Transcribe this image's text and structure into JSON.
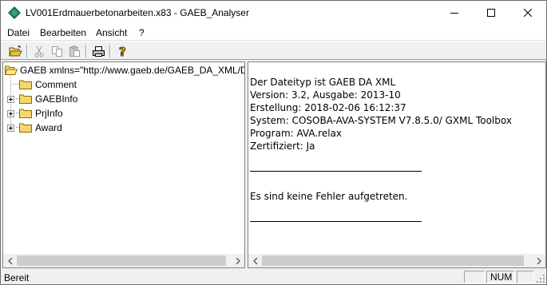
{
  "window": {
    "title": "LV001Erdmauerbetonarbeiten.x83 - GAEB_Analyser"
  },
  "menu": {
    "items": [
      "Datei",
      "Bearbeiten",
      "Ansicht",
      "?"
    ]
  },
  "toolbar": {
    "icons": [
      "open-folder-icon",
      "cut-icon",
      "copy-icon",
      "paste-icon",
      "print-icon",
      "help-icon"
    ]
  },
  "tree": {
    "root_label": "GAEB xmlns=\"http://www.gaeb.de/GAEB_DA_XML/D",
    "children": [
      {
        "label": "Comment",
        "expandable": false
      },
      {
        "label": "GAEBInfo",
        "expandable": true
      },
      {
        "label": "PrjInfo",
        "expandable": true
      },
      {
        "label": "Award",
        "expandable": true
      }
    ]
  },
  "info": {
    "lines": [
      "Der Dateityp ist GAEB DA XML",
      "Version: 3.2, Ausgabe: 2013-10",
      "Erstellung: 2018-02-06 16:12:37",
      "System: COSOBA-AVA-SYSTEM V7.8.5.0/ GXML Toolbox",
      "Program: AVA.relax",
      "Zertifiziert: Ja"
    ],
    "result": "Es sind keine Fehler aufgetreten."
  },
  "status": {
    "text": "Bereit",
    "num": "NUM"
  },
  "colors": {
    "app_icon": "#1e6b52",
    "folder": "#f5d76e",
    "folder_edge": "#c9a227"
  }
}
